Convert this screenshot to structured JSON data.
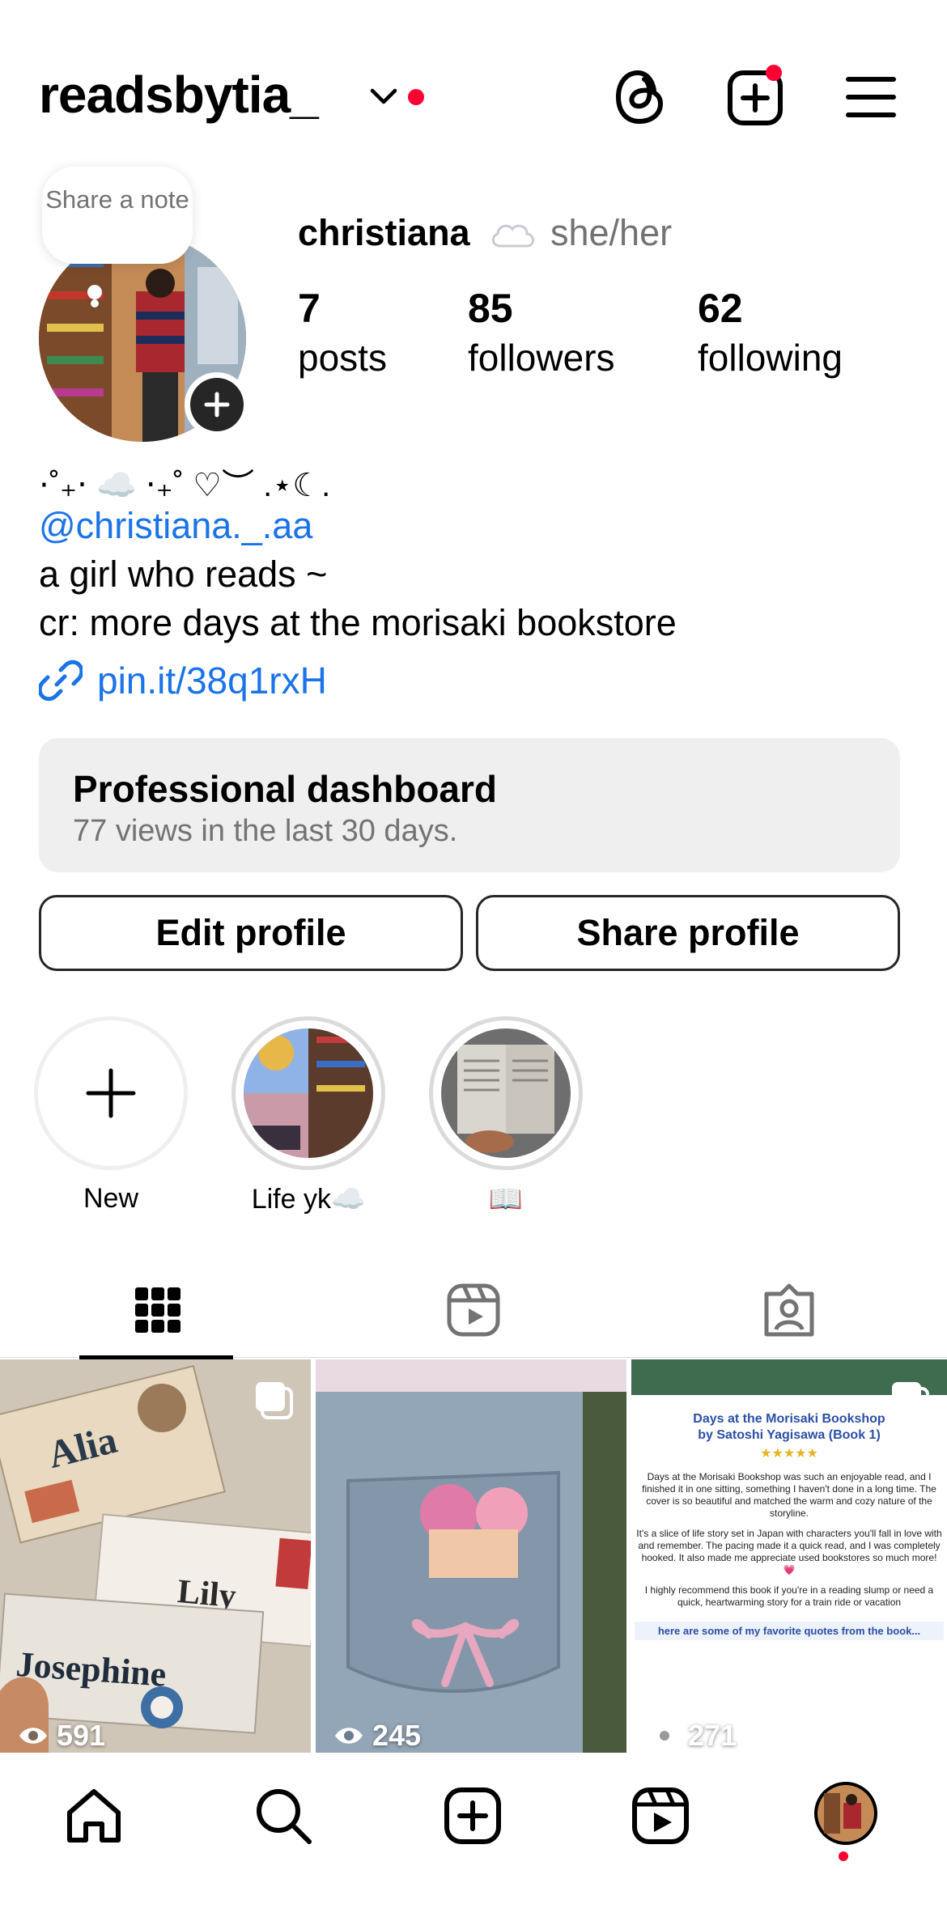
{
  "header": {
    "username": "readsbytia_",
    "threads_icon": "threads-icon",
    "create_icon": "plus-square-icon",
    "menu_icon": "hamburger-menu-icon",
    "accent_red": "#ff0033"
  },
  "profile": {
    "note_text": "Share a note",
    "display_name": "christiana",
    "pronouns": "she/her",
    "stats": [
      {
        "value": "7",
        "label": "posts"
      },
      {
        "value": "85",
        "label": "followers"
      },
      {
        "value": "62",
        "label": "following"
      }
    ]
  },
  "bio": {
    "decor": "⋅˚₊‧ ☁️ ‧₊˚ ♡︶ .⋆☾.",
    "mention": "@christiana._.aa",
    "line1": "a girl who reads ~",
    "line2": "cr: more days at the morisaki bookstore",
    "link": "pin.it/38q1rxH",
    "link_color": "#1a73e8"
  },
  "dashboard": {
    "title": "Professional dashboard",
    "subtitle": "77 views in the last 30 days."
  },
  "buttons": {
    "edit": "Edit profile",
    "share": "Share profile"
  },
  "highlights": [
    {
      "label": "New"
    },
    {
      "label": "Life yk☁️"
    },
    {
      "label": "📖"
    }
  ],
  "tabs": [
    "grid-icon",
    "reels-icon",
    "tagged-icon"
  ],
  "posts": [
    {
      "views": "591",
      "multi": true
    },
    {
      "views": "245",
      "multi": false
    },
    {
      "views": "271",
      "multi": true,
      "review_title": "Days at the Morisaki Bookshop\nby Satoshi Yagisawa (Book 1)",
      "stars": "★★★★★",
      "review_p1": "Days at the Morisaki Bookshop was such an enjoyable read, and I finished it in one sitting, something I haven't done in a long time. The cover is so beautiful and matched the warm and cozy nature of the storyline.",
      "review_p2": "It's a slice of life story set in Japan with characters you'll fall in love with and remember. The pacing made it a quick read, and I was completely hooked. It also made me appreciate used bookstores so much more! 💗",
      "review_p3": "I highly recommend this book if you're in a reading slump or need a quick, heartwarming story for a train ride or vacation",
      "review_footer": "here are some of my favorite quotes from the book..."
    }
  ],
  "post_art_text": {
    "name1": "Alia",
    "name2": "Lily",
    "name3": "Josephine"
  },
  "nav": [
    "home-icon",
    "search-icon",
    "create-icon",
    "reels-icon",
    "profile-avatar"
  ]
}
